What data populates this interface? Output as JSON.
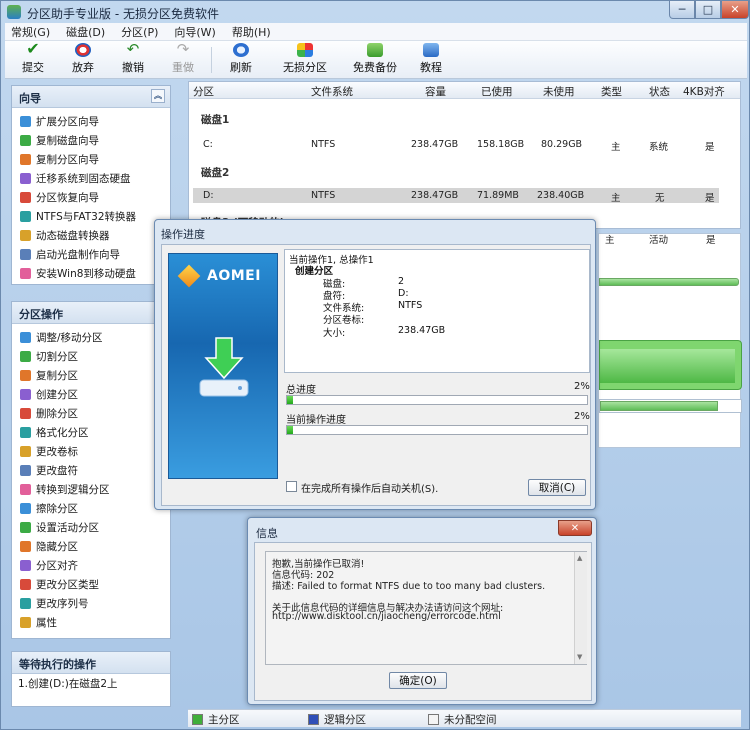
{
  "window": {
    "title": "分区助手专业版 - 无损分区免费软件",
    "minimize": "─",
    "maximize": "□",
    "close": "✕"
  },
  "menu": [
    "常规(G)",
    "磁盘(D)",
    "分区(P)",
    "向导(W)",
    "帮助(H)"
  ],
  "toolbar": {
    "submit": "提交",
    "discard": "放弃",
    "undo": "撤销",
    "redo": "重做",
    "refresh": "刷新",
    "lossless": "无损分区",
    "backup": "免费备份",
    "tutorial": "教程"
  },
  "wizard_panel": {
    "title": "向导",
    "collapse": "︽",
    "items": [
      "扩展分区向导",
      "复制磁盘向导",
      "复制分区向导",
      "迁移系统到固态硬盘",
      "分区恢复向导",
      "NTFS与FAT32转换器",
      "动态磁盘转换器",
      "启动光盘制作向导",
      "安装Win8到移动硬盘"
    ]
  },
  "ops_panel": {
    "title": "分区操作",
    "items": [
      "调整/移动分区",
      "切割分区",
      "复制分区",
      "创建分区",
      "删除分区",
      "格式化分区",
      "更改卷标",
      "更改盘符",
      "转换到逻辑分区",
      "擦除分区",
      "设置活动分区",
      "隐藏分区",
      "分区对齐",
      "更改分区类型",
      "更改序列号",
      "属性"
    ]
  },
  "pending_panel": {
    "title": "等待执行的操作",
    "items": [
      "1.创建(D:)在磁盘2上"
    ]
  },
  "table": {
    "headers": [
      "分区",
      "文件系统",
      "容量",
      "已使用",
      "未使用",
      "类型",
      "状态",
      "4KB对齐"
    ],
    "disks": [
      {
        "name": "磁盘1",
        "rows": [
          [
            "C:",
            "NTFS",
            "238.47GB",
            "158.18GB",
            "80.29GB",
            "主",
            "系统",
            "是"
          ]
        ]
      },
      {
        "name": "磁盘2",
        "rows": [
          [
            "D:",
            "NTFS",
            "238.47GB",
            "71.89MB",
            "238.40GB",
            "主",
            "无",
            "是"
          ]
        ]
      },
      {
        "name": "磁盘3 (可移动的)",
        "rows": [
          [
            "",
            "",
            "",
            "",
            "",
            "主",
            "活动",
            "是"
          ]
        ]
      }
    ]
  },
  "legend": {
    "primary": "主分区",
    "logical": "逻辑分区",
    "unallocated": "未分配空间"
  },
  "progress_dialog": {
    "title": "操作进度",
    "brand": "AOMEI",
    "info": {
      "line1": "当前操作1, 总操作1",
      "op": "创建分区",
      "fields": [
        [
          "磁盘:",
          "2"
        ],
        [
          "盘符:",
          "D:"
        ],
        [
          "文件系统:",
          "NTFS"
        ],
        [
          "分区卷标:",
          ""
        ],
        [
          "大小:",
          "238.47GB"
        ]
      ]
    },
    "total_label": "总进度",
    "total_pct": "2%",
    "total_value": 2,
    "current_label": "当前操作进度",
    "current_pct": "2%",
    "current_value": 2,
    "shutdown_label": "在完成所有操作后自动关机(S).",
    "cancel": "取消(C)"
  },
  "info_dialog": {
    "title": "信息",
    "close": "✕",
    "lines": [
      "抱歉,当前操作已取消!",
      "信息代码: 202",
      "描述: Failed to format NTFS due to too many bad clusters.",
      "",
      "关于此信息代码的详细信息与解决办法请访问这个网址:",
      "http://www.disktool.cn/jiaocheng/errorcode.html"
    ],
    "ok": "确定(O)"
  },
  "colors": {
    "primary": "#3fae3a",
    "logical": "#2f4fb8",
    "unallocated": "#f4f4f4",
    "selected": "#d4d4d4"
  }
}
